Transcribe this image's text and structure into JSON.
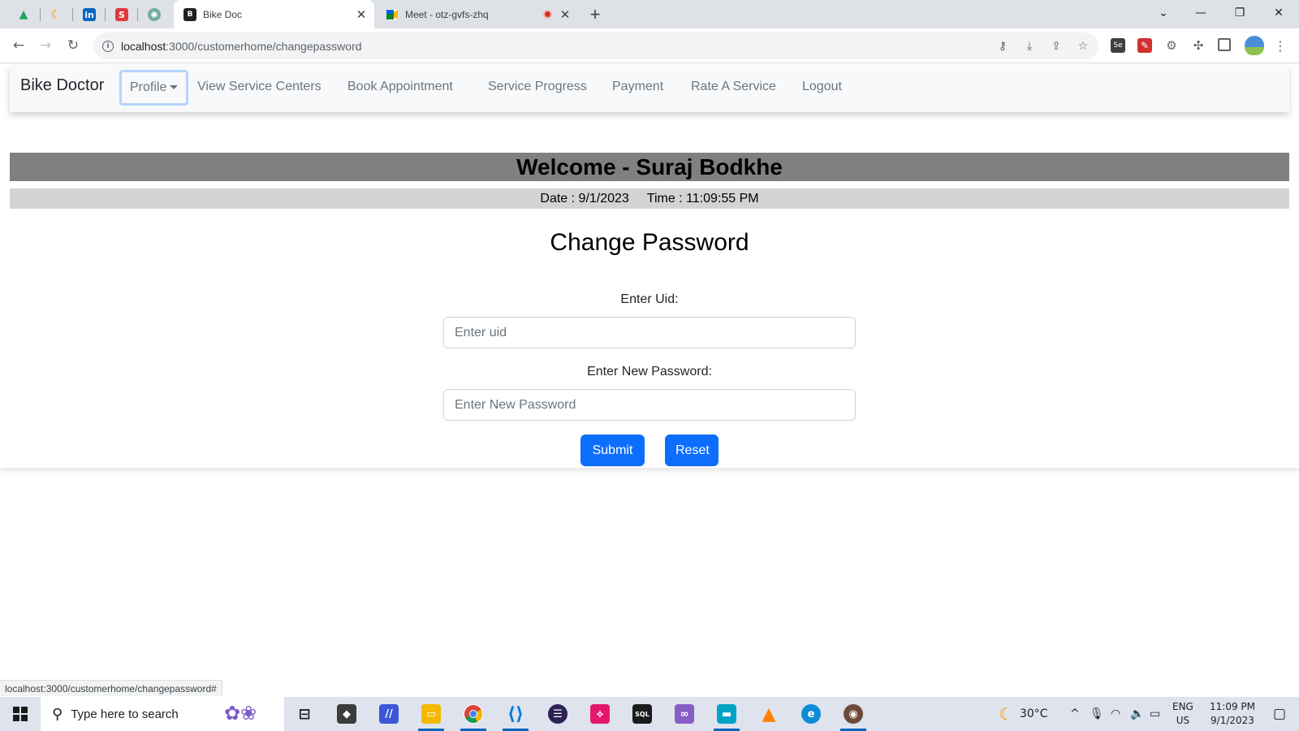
{
  "browser": {
    "pinned_tabs": [
      {
        "name": "google-drive-tab",
        "icon": "google-drive-icon",
        "glyph": "▲",
        "color": "#1fa463"
      },
      {
        "name": "pinned-tab-2",
        "icon": "crescent-logo-icon",
        "glyph": "☾",
        "color": "#f29900"
      },
      {
        "name": "linkedin-tab",
        "icon": "linkedin-icon",
        "glyph": "in",
        "color": "#0a66c2"
      },
      {
        "name": "pinned-tab-4",
        "icon": "s-logo-icon",
        "glyph": "S",
        "color": "#e0393e"
      },
      {
        "name": "chatgpt-tab",
        "icon": "chatgpt-icon",
        "glyph": "✺",
        "color": "#74aa9c"
      }
    ],
    "active_tab": {
      "title": "Bike Doc",
      "icon": "bike-doc-favicon"
    },
    "second_tab": {
      "title": "Meet - otz-gvfs-zhq",
      "icon": "google-meet-icon"
    },
    "url_host": "localhost",
    "url_path": ":3000/customerhome/changepassword",
    "status_url": "localhost:3000/customerhome/changepassword#"
  },
  "navbar": {
    "brand": "Bike Doctor",
    "profile": "Profile",
    "links": [
      "View Service Centers",
      "Book Appointment",
      "Service Progress",
      "Payment",
      "Rate A Service",
      "Logout"
    ]
  },
  "welcome": "Welcome - Suraj Bodkhe",
  "datetime": "Date : 9/1/2023     Time : 11:09:55 PM",
  "form": {
    "title": "Change Password",
    "uid_label": "Enter Uid:",
    "uid_placeholder": "Enter uid",
    "password_label": "Enter New Password:",
    "password_placeholder": "Enter New Password",
    "submit_label": "Submit",
    "reset_label": "Reset"
  },
  "taskbar": {
    "search_placeholder": "Type here to search",
    "weather": "30°C",
    "lang": "ENG",
    "region": "US",
    "time": "11:09 PM",
    "date": "9/1/2023"
  },
  "colors": {
    "primary": "#0d6efd",
    "welcome_bg": "#808080",
    "datetime_bg": "#d3d3d3"
  }
}
